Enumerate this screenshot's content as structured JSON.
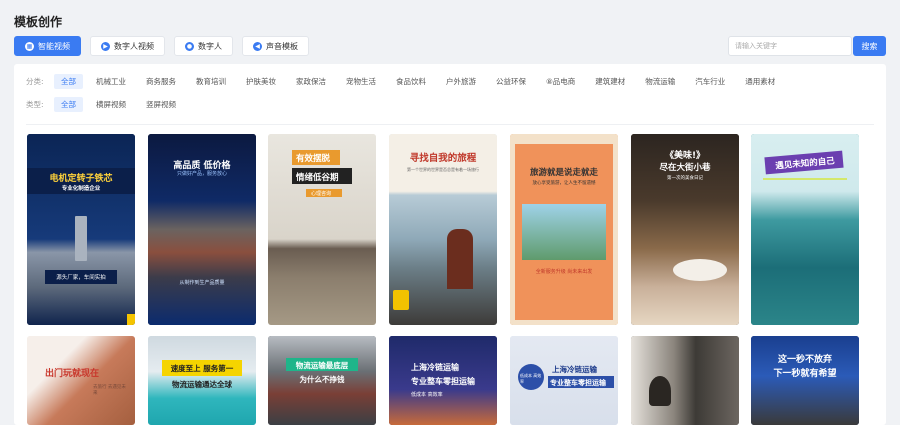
{
  "page_title": "模板创作",
  "modes": [
    {
      "label": "智能视频",
      "active": true,
      "icon": "smart-video-icon"
    },
    {
      "label": "数字人视频",
      "active": false,
      "icon": "play-icon"
    },
    {
      "label": "数字人",
      "active": false,
      "icon": "avatar-icon"
    },
    {
      "label": "声音模板",
      "active": false,
      "icon": "speaker-icon"
    }
  ],
  "search": {
    "placeholder": "请输入关键字",
    "button": "搜索"
  },
  "filters": {
    "category_label": "分类:",
    "categories": [
      "全部",
      "机械工业",
      "商务服务",
      "教育培训",
      "护肤美妆",
      "家政保洁",
      "宠物生活",
      "食品饮料",
      "户外旅游",
      "公益环保",
      "⑧品电商",
      "建筑建材",
      "物流运输",
      "汽车行业",
      "通用素材"
    ],
    "category_selected": 0,
    "type_label": "类型:",
    "types": [
      "全部",
      "横屏视频",
      "竖屏视频"
    ],
    "type_selected": 0
  },
  "cards": [
    {
      "name": "template-card-machinery",
      "title": "电机定转子铁芯",
      "sub": "专业化制造企业",
      "foot": "源头厂家，车间实拍"
    },
    {
      "name": "template-card-quality-price",
      "title": "高品质 低价格",
      "sub": "只做好产品，服务放心",
      "foot": "从制作到生产品质量"
    },
    {
      "name": "template-card-anxiety",
      "title": "有效摆脱",
      "sub": "情绪低谷期",
      "foot": "心理咨询"
    },
    {
      "name": "template-card-journey",
      "title": "寻找自我的旅程",
      "sub": "第一个世界的世界是否总是有着一场旅行",
      "foot": ""
    },
    {
      "name": "template-card-travel",
      "title": "旅游就是说走就走",
      "sub": "放心享受旅游，让人生不留遗憾",
      "foot": "全新服务升级 尚未来出发"
    },
    {
      "name": "template-card-food-alley",
      "title": "《美味!》",
      "sub": "尽在大街小巷",
      "foot": "第一次的美食日记"
    },
    {
      "name": "template-card-surf",
      "title": "遇见未知的自己",
      "sub": "",
      "foot": ""
    },
    {
      "name": "template-card-outdoor",
      "title": "出门玩就现在",
      "sub": "去旅行 去遇见未来",
      "foot": ""
    },
    {
      "name": "template-card-logistics-national",
      "title": "速度至上 服务第一",
      "sub": "物流运输通达全球",
      "foot": ""
    },
    {
      "name": "template-card-logistics-cheap",
      "title": "物流运输最底层",
      "sub": "为什么不挣钱",
      "foot": ""
    },
    {
      "name": "template-card-cold-chain",
      "title": "上海冷链运输",
      "sub": "专业整车零担运输",
      "foot": "低成本 高效率"
    },
    {
      "name": "template-card-cold-chain-2",
      "title": "上海冷链运输",
      "sub": "专业整车零担运输",
      "foot": "低成本 高效率"
    },
    {
      "name": "template-card-reader",
      "title": "",
      "sub": "",
      "foot": ""
    },
    {
      "name": "template-card-never-give-up",
      "title": "这一秒不放弃",
      "sub": "下一秒就有希望",
      "foot": ""
    }
  ]
}
